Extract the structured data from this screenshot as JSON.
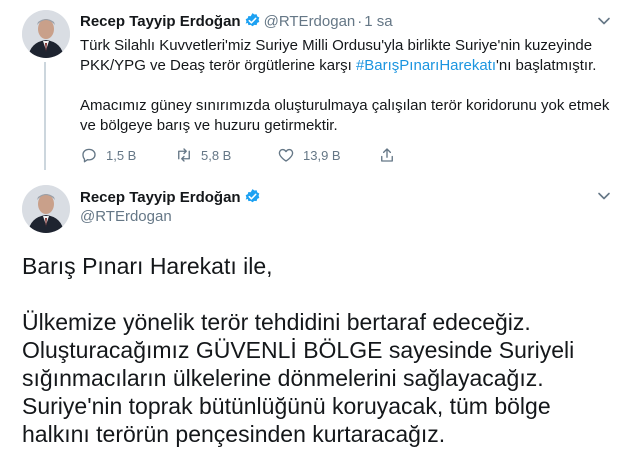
{
  "tweet1": {
    "author_name": "Recep Tayyip Erdoğan",
    "handle": "@RTErdogan",
    "separator": "·",
    "time": "1 sa",
    "text_part1": "Türk Silahlı Kuvvetleri'miz Suriye Milli Ordusu'yla birlikte Suriye'nin kuzeyinde PKK/YPG ve Deaş terör örgütlerine karşı ",
    "hashtag": "#BarışPınarıHarekatı",
    "text_part2": "'nı başlatmıştır.",
    "paragraph2": "Amacımız güney sınırımızda oluşturulmaya çalışılan terör koridorunu yok etmek ve bölgeye barış ve huzuru getirmektir.",
    "reply_count": "1,5 B",
    "retweet_count": "5,8 B",
    "like_count": "13,9 B"
  },
  "tweet2": {
    "author_name": "Recep Tayyip Erdoğan",
    "handle": "@RTErdogan",
    "intro": "Barış Pınarı Harekatı ile,",
    "lines": [
      "Ülkemize yönelik terör tehdidini bertaraf edeceğiz.",
      "Oluşturacağımız GÜVENLİ BÖLGE sayesinde Suriyeli",
      "sığınmacıların ülkelerine dönmelerini sağlayacağız.",
      "Suriye'nin toprak bütünlüğünü koruyacak, tüm bölge",
      "halkını terörün pençesinden kurtaracağız."
    ]
  },
  "colors": {
    "link": "#1b95e0",
    "verified": "#1da1f2",
    "muted": "#657786",
    "text": "#14171a"
  },
  "icons": [
    "verified-badge-icon",
    "chevron-down-icon",
    "reply-icon",
    "retweet-icon",
    "like-icon",
    "share-icon"
  ]
}
